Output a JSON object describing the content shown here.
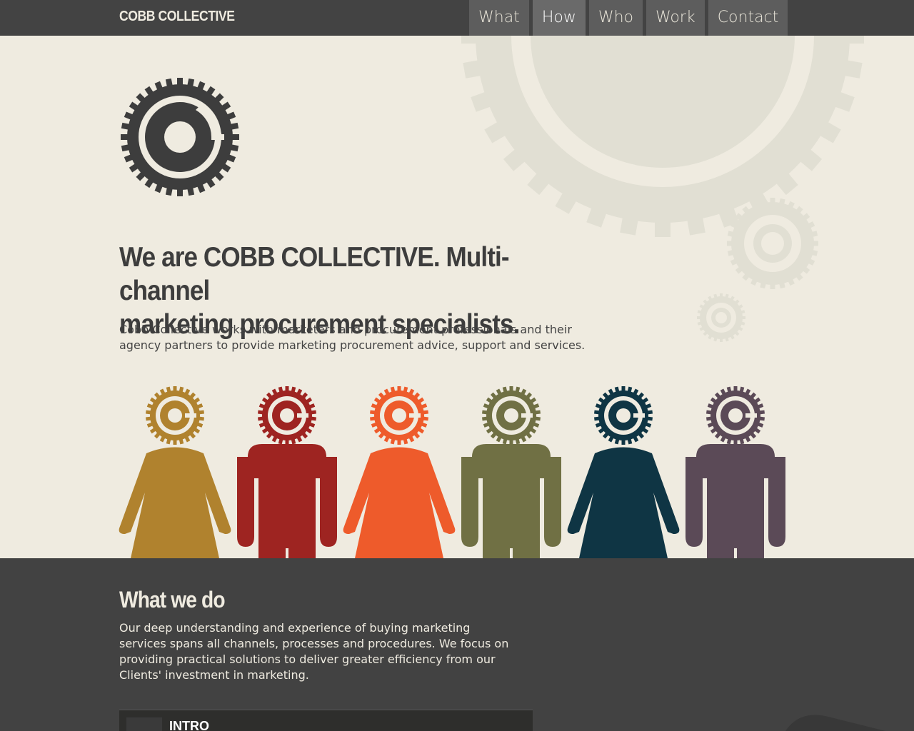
{
  "brand": "COBB COLLECTIVE",
  "nav": {
    "items": [
      {
        "label": "What"
      },
      {
        "label": "How"
      },
      {
        "label": "Who"
      },
      {
        "label": "Work"
      },
      {
        "label": "Contact"
      }
    ],
    "active": "How"
  },
  "hero": {
    "headline_line1": "We are COBB COLLECTIVE. Multi-channel",
    "headline_line2": "marketing procurement specialists.",
    "intro_line1": "Cobb Collective works with marketers and procurement professionals and their",
    "intro_line2": "agency partners to provide marketing procurement advice, support and services."
  },
  "people": [
    {
      "figure": "female",
      "color": "#b0822e"
    },
    {
      "figure": "male",
      "color": "#9e2421"
    },
    {
      "figure": "female",
      "color": "#ee5b2b"
    },
    {
      "figure": "male",
      "color": "#707044"
    },
    {
      "figure": "female",
      "color": "#0f3544"
    },
    {
      "figure": "male",
      "color": "#5b4a57"
    }
  ],
  "what_we_do": {
    "title": "What we do",
    "body_line1": "Our deep understanding and experience of buying marketing",
    "body_line2": "services spans all channels, processes and procedures. We focus on",
    "body_line3": "providing practical solutions to deliver greater efficiency from our",
    "body_line4": "Clients' investment in marketing.",
    "video_label": "INTRO"
  },
  "colors": {
    "topbar": "#434343",
    "background": "#efebe0",
    "dark_section": "#424242"
  }
}
